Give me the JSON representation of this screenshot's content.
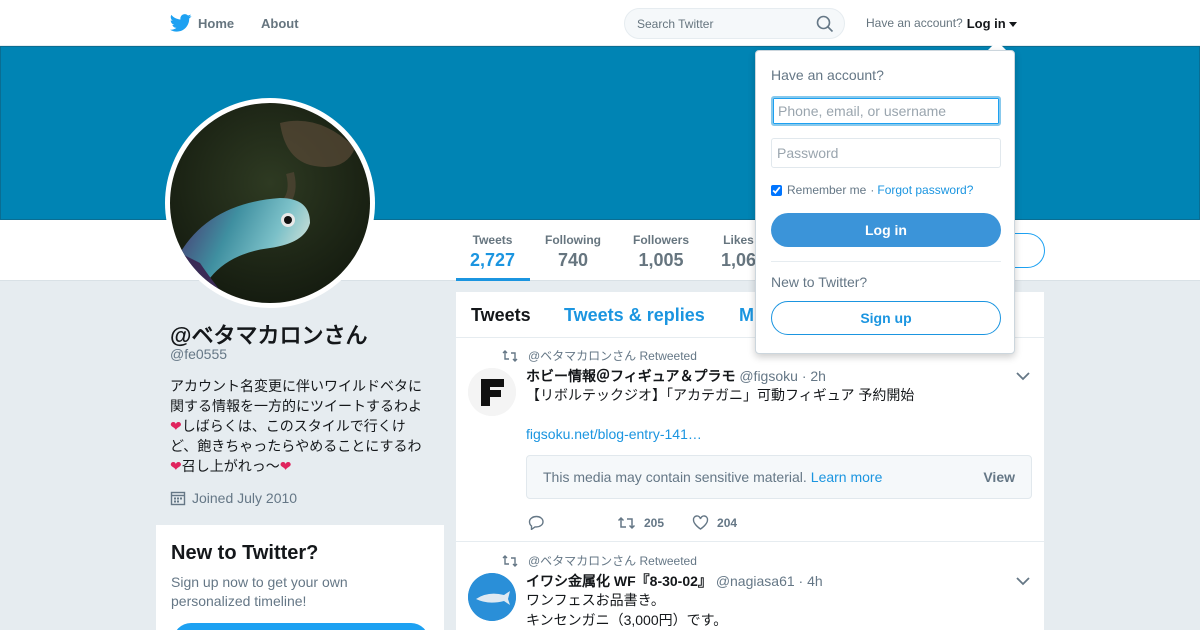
{
  "nav": {
    "home_label": "Home",
    "about_label": "About",
    "search_placeholder": "Search Twitter",
    "have_account": "Have an account?",
    "login_label": "Log in"
  },
  "stats": [
    {
      "label": "Tweets",
      "value": "2,727"
    },
    {
      "label": "Following",
      "value": "740"
    },
    {
      "label": "Followers",
      "value": "1,005"
    },
    {
      "label": "Likes",
      "value": "1,06"
    }
  ],
  "profile": {
    "name": "@ベタマカロンさん",
    "handle": "@fe0555",
    "bio_lines": [
      "アカウント名変更に伴いワイルドベタに",
      "関する情報を一方的にツイートするわよ",
      "しばらくは、このスタイルで行くけ",
      "ど、飽きちゃったらやめることにするわ",
      "召し上がれっ〜"
    ],
    "joined": "Joined July 2010"
  },
  "new_card": {
    "title": "New to Twitter?",
    "subtitle_line1": "Sign up now to get your own",
    "subtitle_line2": "personalized timeline!"
  },
  "timeline": {
    "tabs": [
      "Tweets",
      "Tweets & replies",
      "M"
    ],
    "tweets": [
      {
        "retweeted_by": "@ベタマカロンさん Retweeted",
        "name": "ホビー情報＠フィギュア＆プラモ",
        "handle": "@figsoku",
        "time": "· 2h",
        "text": "【リボルテックジオ】「アカテガニ」可動フィギュア 予約開始",
        "link": "figsoku.net/blog-entry-141…",
        "sensitive_text": "This media may contain sensitive material.",
        "learn_more": "Learn more",
        "view_label": "View",
        "retweets": "205",
        "likes": "204"
      },
      {
        "retweeted_by": "@ベタマカロンさん Retweeted",
        "name": "イワシ金属化 WF『8-30-02』",
        "handle": "@nagiasa61",
        "time": "· 4h",
        "text_line1": "ワンフェスお品書き。",
        "text_line2": "キンセンガニ（3,000円）です。"
      }
    ]
  },
  "login_dropdown": {
    "title": "Have an account?",
    "username_placeholder": "Phone, email, or username",
    "password_placeholder": "Password",
    "remember_me": "Remember me",
    "separator": "·",
    "forgot_password": "Forgot password?",
    "login_button": "Log in",
    "new_to_twitter": "New to Twitter?",
    "signup_button": "Sign up"
  },
  "colors": {
    "banner": "#0084b4",
    "accent": "#1da1f2",
    "link": "#1b95e0"
  }
}
